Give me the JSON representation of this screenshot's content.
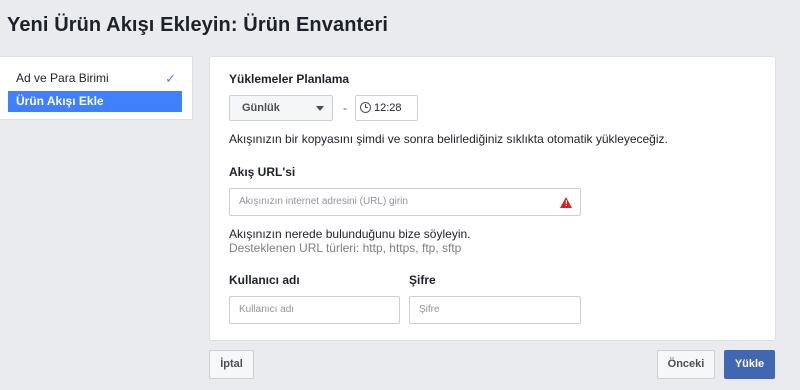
{
  "page": {
    "title": "Yeni Ürün Akışı Ekleyin: Ürün Envanteri"
  },
  "sidebar": {
    "items": [
      {
        "label": "Ad ve Para Birimi",
        "completed": true
      },
      {
        "label": "Ürün Akışı Ekle",
        "active": true
      }
    ]
  },
  "upload_schedule": {
    "label": "Yüklemeler Planlama",
    "frequency": "Günlük",
    "separator": "-",
    "time": "12:28",
    "description": "Akışınızın bir kopyasını şimdi ve sonra belirlediğiniz sıklıkta otomatik yükleyeceğiz."
  },
  "feed_url": {
    "label": "Akış URL'si",
    "placeholder": "Akışınızın internet adresini (URL) girin",
    "help": "Akışınızın nerede bulunduğunu bize söyleyin.",
    "supported": "Desteklenen URL türleri: http, https, ftp, sftp"
  },
  "username": {
    "label": "Kullanıcı adı",
    "placeholder": "Kullanıcı adı"
  },
  "password": {
    "label": "Şifre",
    "placeholder": "Şifre"
  },
  "footer": {
    "cancel_label": "İptal",
    "previous_label": "Önceki",
    "upload_label": "Yükle"
  },
  "colors": {
    "accent": "#4080ff",
    "primary_button": "#4267b2",
    "warning": "#e02020"
  },
  "icons": {
    "check": "check-icon",
    "clock": "clock-icon",
    "warning": "warning-icon",
    "caret": "chevron-down-icon"
  }
}
